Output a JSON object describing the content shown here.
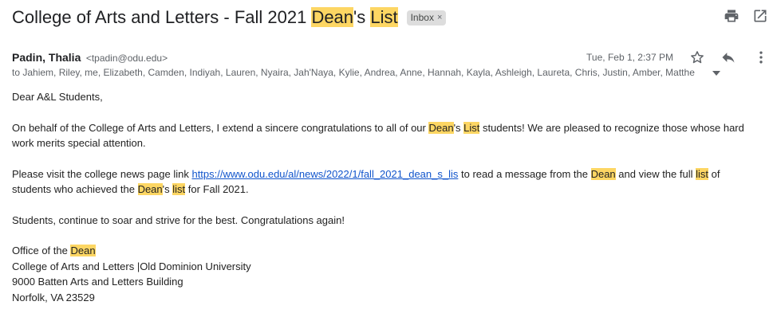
{
  "subject": {
    "title_part1": "College of Arts and Letters - Fall 2021 ",
    "hl_dean": "Dean",
    "title_part2": "'s ",
    "hl_list": "List",
    "badge": "Inbox",
    "badge_close": "×"
  },
  "toolbar": {
    "print_icon": "print-icon",
    "popout_icon": "open-in-new-window-icon"
  },
  "message": {
    "sender_name": "Padin, Thalia",
    "sender_email": "<tpadin@odu.edu>",
    "recipients": "to Jahiem, Riley, me, Elizabeth, Camden, Indiyah, Lauren, Nyaira, Jah'Naya, Kylie, Andrea, Anne, Hannah, Kayla, Ashleigh, Laureta, Chris, Justin, Amber, Matthe",
    "date": "Tue, Feb 1, 2:37 PM"
  },
  "body": {
    "greeting": "Dear A&L Students,",
    "p1_a": "On behalf of the College of Arts and Letters, I extend a sincere congratulations to all of our ",
    "p1_dean": "Dean",
    "p1_b": "'s ",
    "p1_list": "List",
    "p1_c": " students! We are pleased to recognize those whose hard work merits special attention.",
    "p2_a": "Please visit the college news page link ",
    "p2_link": "https://www.odu.edu/al/news/2022/1/fall_2021_dean_s_lis",
    "p2_b": " to read a message from the ",
    "p2_dean": "Dean",
    "p2_c": " and view the full ",
    "p2_list": "list",
    "p2_d": " of students who achieved the ",
    "p2_dean2": "Dean",
    "p2_e": "'s ",
    "p2_list2": "list",
    "p2_f": " for Fall 2021.",
    "p3": "Students, continue to soar and strive for the best. Congratulations again!",
    "sig_office": "Office of the ",
    "sig_dean": "Dean",
    "sig_line2": "College of Arts and Letters |Old Dominion University",
    "sig_line3": "9000 Batten Arts and Letters Building",
    "sig_line4": "Norfolk, VA 23529"
  },
  "colors": {
    "highlight": "#fdd663",
    "link": "#1155cc",
    "badge_bg": "#dddddd"
  }
}
